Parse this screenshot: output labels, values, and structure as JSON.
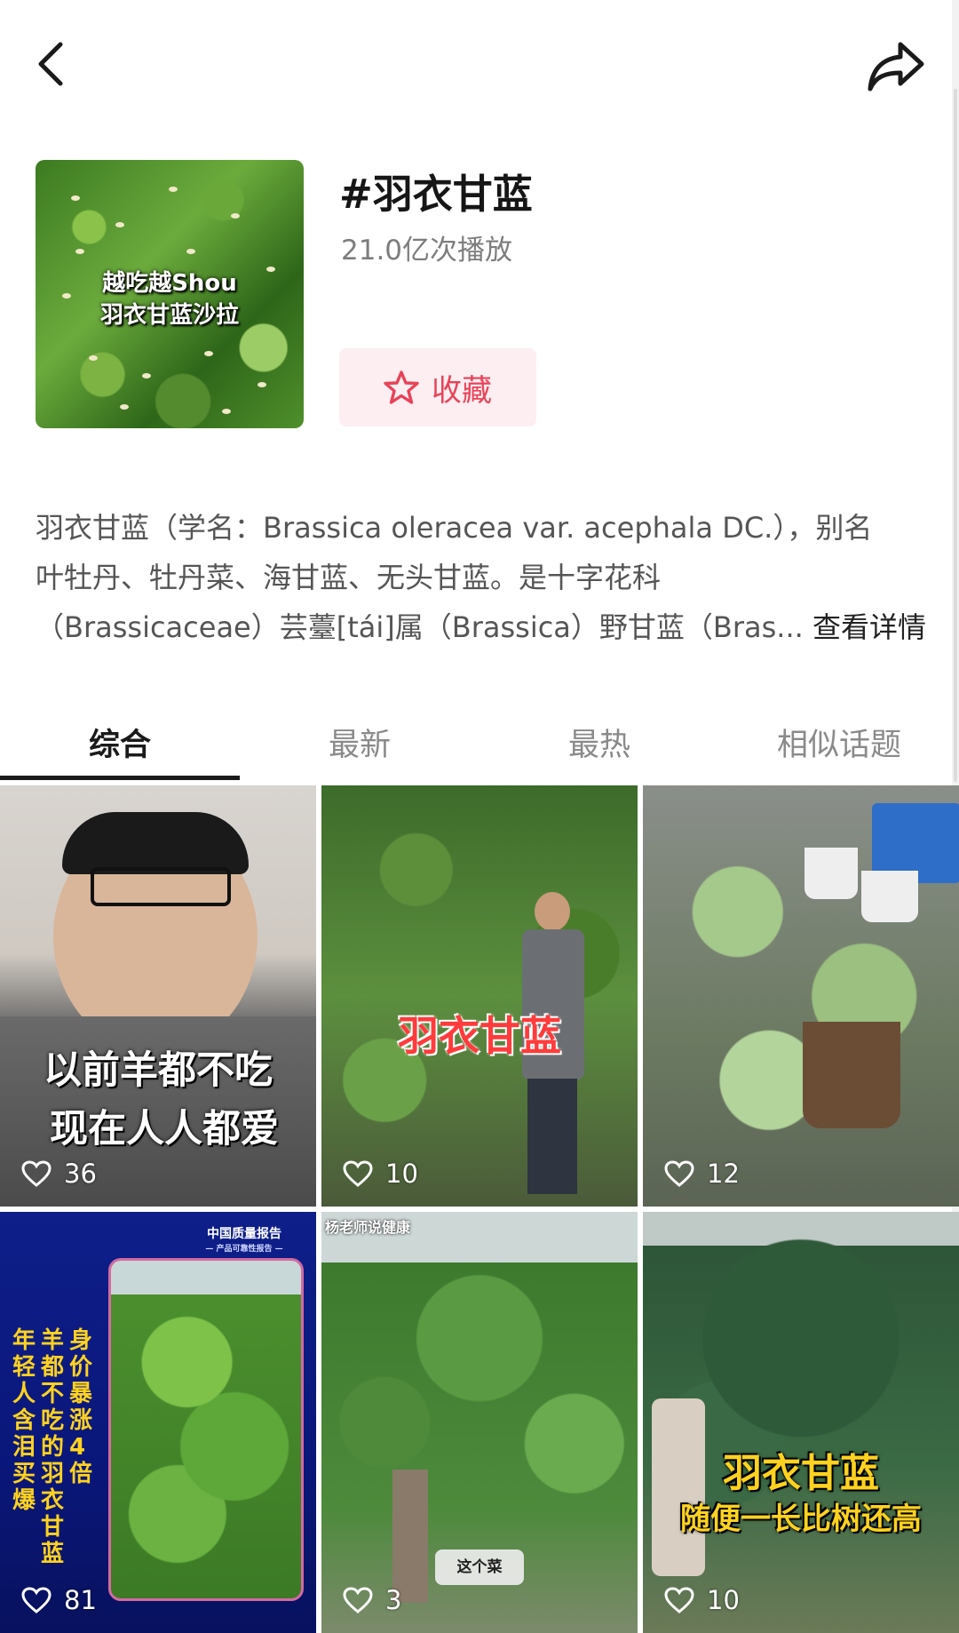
{
  "topic": {
    "title": "#羽衣甘蓝",
    "play_count": "21.0亿次播放",
    "favorite_label": "收藏",
    "cover_text_line1": "越吃越Shou",
    "cover_text_line2": "羽衣甘蓝沙拉"
  },
  "description": {
    "line1": "羽衣甘蓝（学名：Brassica oleracea var. acephala DC.），别名",
    "line2": "叶牡丹、牡丹菜、海甘蓝、无头甘蓝。是十字花科",
    "line3": "（Brassicaceae）芸薹[tái]属（Brassica）野甘蓝（Bras...",
    "more_link": "查看详情"
  },
  "tabs": [
    "综合",
    "最新",
    "最热",
    "相似话题"
  ],
  "active_tab_index": 0,
  "videos": [
    {
      "overlay_line1": "以前羊都不吃",
      "overlay_line2": "现在人人都爱",
      "likes": "36"
    },
    {
      "overlay_line1": "羽衣甘蓝",
      "likes": "10"
    },
    {
      "likes": "12"
    },
    {
      "badge": "中国质量报告",
      "badge_sub": "— 产品可靠性报告 —",
      "vtext1": "身价暴涨4倍",
      "vtext2": "羊都不吃的羽衣甘蓝",
      "vtext3": "年轻人含泪买爆",
      "likes": "81"
    },
    {
      "tag": "杨老师说健康",
      "caption": "这个菜",
      "likes": "3"
    },
    {
      "overlay_line1": "羽衣甘蓝",
      "overlay_line2": "随便一长比树还高",
      "likes": "10"
    }
  ],
  "colors": {
    "accent": "#e94359",
    "fav_bg": "#fdeef1",
    "title_yellow": "#ffd21f",
    "red_text": "#ff3b3b"
  },
  "icons": {
    "back": "back-arrow-icon",
    "share": "share-icon",
    "star": "star-icon",
    "heart": "heart-icon"
  }
}
